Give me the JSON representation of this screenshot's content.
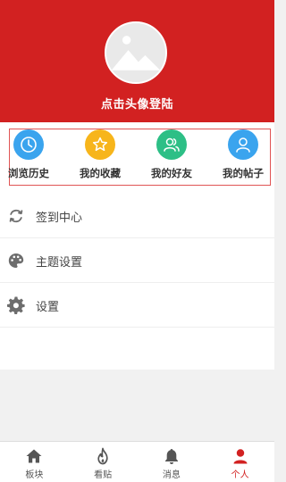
{
  "colors": {
    "header_bg": "#d22121",
    "accent": "#d22121",
    "history_icon_bg": "#3aa4ee",
    "favorites_icon_bg": "#f7b51b",
    "friends_icon_bg": "#2dbf86",
    "posts_icon_bg": "#3aa4ee",
    "menu_icon": "#6d6d6d",
    "tab_icon_inactive": "#555555"
  },
  "header": {
    "avatar_icon": "image-placeholder-icon",
    "login_prompt": "点击头像登陆"
  },
  "quick_links": [
    {
      "label": "浏览历史",
      "icon": "clock-icon"
    },
    {
      "label": "我的收藏",
      "icon": "star-icon"
    },
    {
      "label": "我的好友",
      "icon": "friends-icon"
    },
    {
      "label": "我的帖子",
      "icon": "user-icon"
    }
  ],
  "menu": [
    {
      "label": "签到中心",
      "icon": "refresh-icon"
    },
    {
      "label": "主题设置",
      "icon": "palette-icon"
    },
    {
      "label": "设置",
      "icon": "gear-icon"
    }
  ],
  "tabbar": {
    "active_index": 3,
    "tabs": [
      {
        "label": "板块",
        "icon": "home-icon"
      },
      {
        "label": "看贴",
        "icon": "flame-icon"
      },
      {
        "label": "消息",
        "icon": "bell-icon"
      },
      {
        "label": "个人",
        "icon": "person-icon"
      }
    ]
  }
}
